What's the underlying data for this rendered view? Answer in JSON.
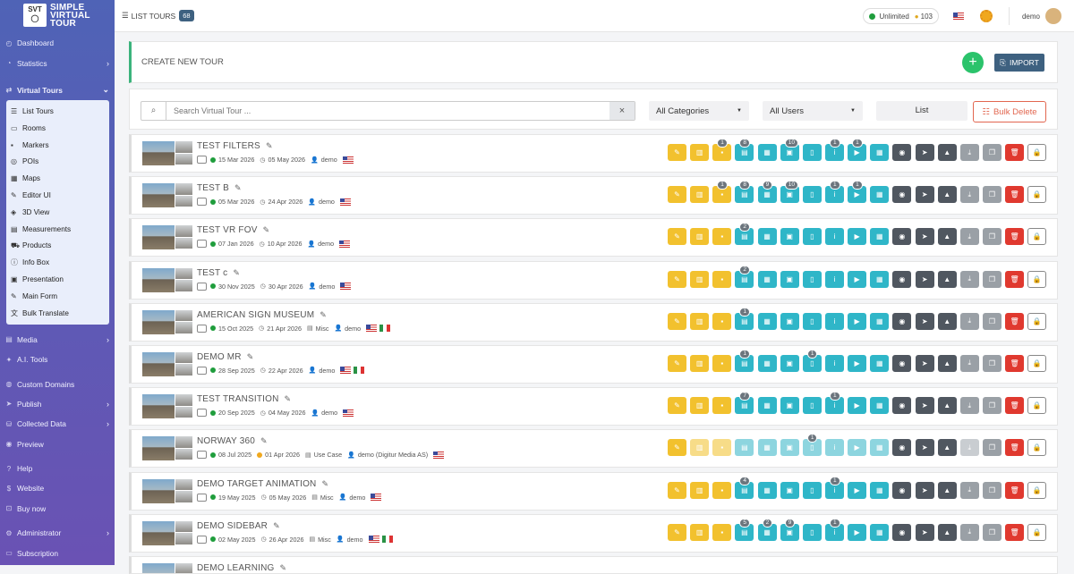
{
  "app": {
    "logo_abbr": "SVT",
    "brand_line1": "SIMPLE",
    "brand_line2": "VIRTUAL",
    "brand_line3": "TOUR"
  },
  "sidebar": {
    "items_top": [
      {
        "label": "Dashboard",
        "icon": "gauge-icon",
        "chev": false
      },
      {
        "label": "Statistics",
        "icon": "pie-icon",
        "chev": true
      }
    ],
    "virtual_tours": {
      "label": "Virtual Tours",
      "icon": "route-icon"
    },
    "sub_items": [
      {
        "label": "List Tours",
        "icon": "list-icon"
      },
      {
        "label": "Rooms",
        "icon": "door-icon"
      },
      {
        "label": "Markers",
        "icon": "marker-icon"
      },
      {
        "label": "POIs",
        "icon": "poi-icon"
      },
      {
        "label": "Maps",
        "icon": "map-icon"
      },
      {
        "label": "Editor UI",
        "icon": "paint-icon"
      },
      {
        "label": "3D View",
        "icon": "cube-icon"
      },
      {
        "label": "Measurements",
        "icon": "ruler-icon"
      },
      {
        "label": "Products",
        "icon": "cart-icon"
      },
      {
        "label": "Info Box",
        "icon": "info-icon"
      },
      {
        "label": "Presentation",
        "icon": "screen-icon"
      },
      {
        "label": "Main Form",
        "icon": "form-icon"
      },
      {
        "label": "Bulk Translate",
        "icon": "translate-icon"
      }
    ],
    "items_bottom": [
      {
        "label": "Media",
        "icon": "media-icon",
        "chev": true,
        "gap": false
      },
      {
        "label": "A.I. Tools",
        "icon": "ai-icon",
        "chev": false,
        "gap": false
      },
      {
        "label": "Custom Domains",
        "icon": "globe-icon",
        "chev": false,
        "gap": true
      },
      {
        "label": "Publish",
        "icon": "send-icon",
        "chev": true,
        "gap": false
      },
      {
        "label": "Collected Data",
        "icon": "database-icon",
        "chev": true,
        "gap": false
      },
      {
        "label": "Preview",
        "icon": "eye-icon",
        "chev": false,
        "gap": false
      },
      {
        "label": "Help",
        "icon": "help-icon",
        "chev": false,
        "gap": true
      },
      {
        "label": "Website",
        "icon": "dollar-icon",
        "chev": false,
        "gap": false
      },
      {
        "label": "Buy now",
        "icon": "bag-icon",
        "chev": false,
        "gap": false
      },
      {
        "label": "Administrator",
        "icon": "admin-icon",
        "chev": true,
        "gap": true
      },
      {
        "label": "Subscription",
        "icon": "card-icon",
        "chev": false,
        "gap": false
      }
    ]
  },
  "topbar": {
    "title": "LIST TOURS",
    "count": "68",
    "plan": "Unlimited",
    "credits": "103",
    "user": "demo"
  },
  "create": {
    "label": "CREATE NEW TOUR",
    "plus": "+",
    "import": "IMPORT"
  },
  "filters": {
    "search_placeholder": "Search Virtual Tour ...",
    "clear": "×",
    "category": "All Categories",
    "users": "All Users",
    "view": "List",
    "bulk_delete": "Bulk Delete"
  },
  "colors": {
    "sidebar_top": "#4f63b6",
    "accent_green": "#2bc36b",
    "yellow": "#f2c12e",
    "cyan": "#2fb6c8",
    "dark": "#505760",
    "red": "#e0392f"
  },
  "tours": [
    {
      "name": "TEST FILTERS",
      "created": "15 Mar 2026",
      "modified": "05 May 2026",
      "category": "",
      "author": "demo",
      "flags": [
        "us"
      ],
      "badges": [
        "",
        "",
        "1",
        "8",
        "",
        "10",
        "",
        "1",
        "1",
        "",
        "",
        "",
        "",
        "",
        "",
        "",
        ""
      ],
      "dim": false
    },
    {
      "name": "TEST B",
      "created": "05 Mar 2026",
      "modified": "24 Apr 2026",
      "category": "",
      "author": "demo",
      "flags": [
        "us"
      ],
      "badges": [
        "",
        "",
        "1",
        "8",
        "9",
        "10",
        "",
        "1",
        "1",
        "",
        "",
        "",
        "",
        "",
        "",
        "",
        ""
      ],
      "dim": false
    },
    {
      "name": "TEST VR FOV",
      "created": "07 Jan 2026",
      "modified": "10 Apr 2026",
      "category": "",
      "author": "demo",
      "flags": [
        "us"
      ],
      "badges": [
        "",
        "",
        "",
        "2",
        "",
        "",
        "",
        "",
        "",
        "",
        "",
        "",
        "",
        "",
        "",
        "",
        ""
      ],
      "dim": false
    },
    {
      "name": "TEST c",
      "created": "30 Nov 2025",
      "modified": "30 Apr 2026",
      "category": "",
      "author": "demo",
      "flags": [
        "us"
      ],
      "badges": [
        "",
        "",
        "",
        "2",
        "",
        "",
        "",
        "",
        "",
        "",
        "",
        "",
        "",
        "",
        "",
        "",
        ""
      ],
      "dim": false
    },
    {
      "name": "AMERICAN SIGN MUSEUM",
      "created": "15 Oct 2025",
      "modified": "21 Apr 2026",
      "category": "Misc",
      "author": "demo",
      "flags": [
        "us",
        "it"
      ],
      "badges": [
        "",
        "",
        "",
        "1",
        "",
        "",
        "",
        "",
        "",
        "",
        "",
        "",
        "",
        "",
        "",
        "",
        ""
      ],
      "dim": false
    },
    {
      "name": "DEMO MR",
      "created": "28 Sep 2025",
      "modified": "22 Apr 2026",
      "category": "",
      "author": "demo",
      "flags": [
        "us",
        "it"
      ],
      "badges": [
        "",
        "",
        "",
        "1",
        "",
        "",
        "1",
        "",
        "",
        "",
        "",
        "",
        "",
        "",
        "",
        "",
        ""
      ],
      "dim": false
    },
    {
      "name": "TEST TRANSITION",
      "created": "20 Sep 2025",
      "modified": "04 May 2026",
      "category": "",
      "author": "demo",
      "flags": [
        "us"
      ],
      "badges": [
        "",
        "",
        "",
        "7",
        "",
        "",
        "",
        "1",
        "",
        "",
        "",
        "",
        "",
        "",
        "",
        "",
        ""
      ],
      "dim": false
    },
    {
      "name": "NORWAY 360",
      "created": "08 Jul 2025",
      "modified": "01 Apr 2026",
      "category": "Use Case",
      "author": "demo (Digitur Media AS)",
      "flags": [
        "us"
      ],
      "badges": [
        "",
        "",
        "",
        "",
        "",
        "",
        "1",
        "",
        "",
        "",
        "",
        "",
        "",
        "",
        "",
        "",
        ""
      ],
      "dim": true
    },
    {
      "name": "DEMO TARGET ANIMATION",
      "created": "19 May 2025",
      "modified": "05 May 2026",
      "category": "Misc",
      "author": "demo",
      "flags": [
        "us"
      ],
      "badges": [
        "",
        "",
        "",
        "4",
        "",
        "",
        "",
        "1",
        "",
        "",
        "",
        "",
        "",
        "",
        "",
        "",
        ""
      ],
      "dim": false
    },
    {
      "name": "DEMO SIDEBAR",
      "created": "02 May 2025",
      "modified": "26 Apr 2026",
      "category": "Misc",
      "author": "demo",
      "flags": [
        "us",
        "it"
      ],
      "badges": [
        "",
        "",
        "",
        "5",
        "2",
        "9",
        "",
        "1",
        "",
        "",
        "",
        "",
        "",
        "",
        "",
        "",
        ""
      ],
      "dim": false
    },
    {
      "name": "DEMO LEARNING",
      "created": "",
      "modified": "",
      "category": "",
      "author": "",
      "flags": [],
      "badges": [],
      "dim": false
    }
  ]
}
